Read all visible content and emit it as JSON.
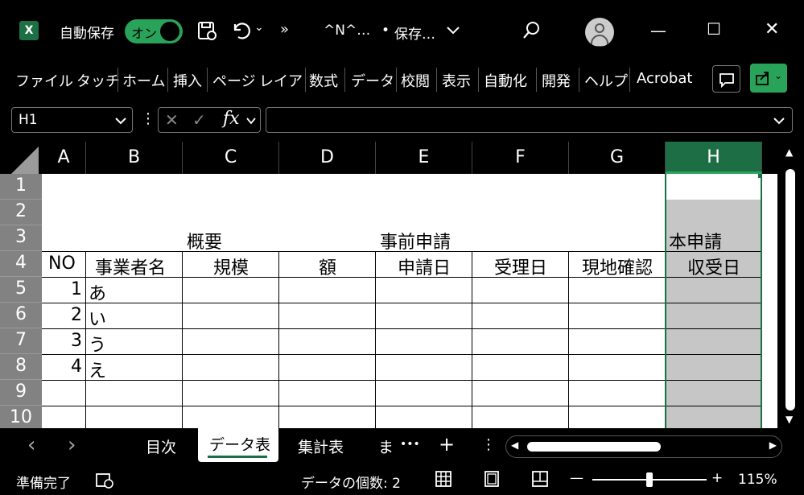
{
  "titlebar": {
    "app_logo": "X",
    "autosave_label": "自動保存",
    "autosave_state": "オン",
    "save_icon": "save-icon",
    "undo_icon": "undo-icon",
    "more": "»",
    "doc_title": "^N^…",
    "dot": "•",
    "saving_status": "保存…",
    "minimize": "—",
    "maximize": "☐",
    "close": "✕"
  },
  "ribbon": {
    "tabs": [
      "ファイル",
      "タッチ",
      "ホーム",
      "挿入",
      "ページ",
      "レイアウ",
      "数式",
      "データ",
      "校閲",
      "表示",
      "自動化",
      "開発",
      "ヘルプ",
      "Acrobat"
    ]
  },
  "formula": {
    "namebox_value": "H1",
    "cancel": "✕",
    "enter": "✓",
    "fx": "fx",
    "formula_value": ""
  },
  "grid": {
    "columns": [
      "A",
      "B",
      "C",
      "D",
      "E",
      "F",
      "G",
      "H"
    ],
    "rows": [
      "1",
      "2",
      "3",
      "4",
      "5",
      "6",
      "7",
      "8",
      "9",
      "10"
    ],
    "cells": {
      "C3": "概要",
      "E3": "事前申請",
      "H3": "本申請",
      "A4": "NO",
      "B4": "事業者名",
      "C4": "規模",
      "D4": "額",
      "E4": "申請日",
      "F4": "受理日",
      "G4": "現地確認",
      "H4": "収受日",
      "A5": "1",
      "B5": "あ",
      "A6": "2",
      "B6": "い",
      "A7": "3",
      "B7": "う",
      "A8": "4",
      "B8": "え"
    }
  },
  "sheets": {
    "prev": "‹",
    "next": "›",
    "tabs": [
      "目次",
      "データ表",
      "集計表",
      "ま"
    ],
    "more": "•••",
    "add": "+",
    "menu": "⋮"
  },
  "status": {
    "ready": "準備完了",
    "count_label": "データの個数: 2",
    "zoom_minus": "—",
    "zoom_plus": "+",
    "zoom": "115%"
  },
  "colors": {
    "accent": "#2aa35a",
    "selected_header": "#1d6e45",
    "selected_fill": "#c6c6c6"
  }
}
